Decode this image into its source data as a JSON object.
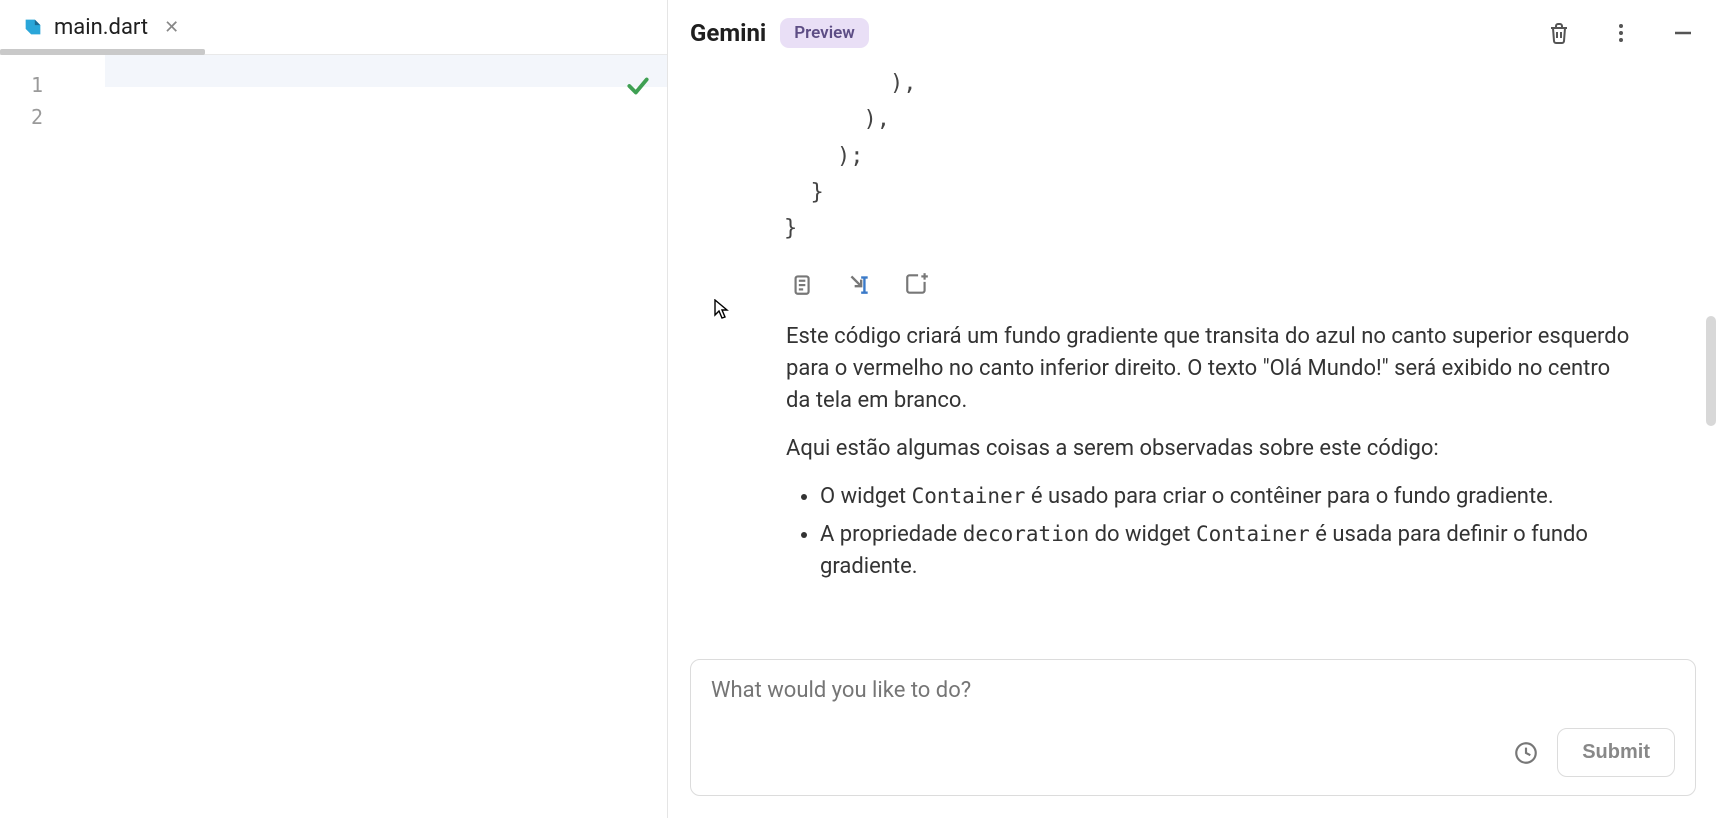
{
  "editor": {
    "tab": {
      "filename": "main.dart"
    },
    "gutter": [
      "1",
      "2"
    ],
    "current_line": 0
  },
  "gemini": {
    "title": "Gemini",
    "badge": "Preview",
    "code_tail": "        ),\n      ),\n    );\n  }\n}",
    "msg": {
      "p1": "Este código criará um fundo gradiente que transita do azul no canto superior esquerdo para o vermelho no canto inferior direito. O texto \"Olá Mundo!\" será exibido no centro da tela em branco.",
      "p2": "Aqui estão algumas coisas a serem observadas sobre este código:",
      "li1_a": "O widget ",
      "li1_code": "Container",
      "li1_b": " é usado para criar o contêiner para o fundo gradiente.",
      "li2_a": "A propriedade ",
      "li2_code1": "decoration",
      "li2_b": " do widget ",
      "li2_code2": "Container",
      "li2_c": " é usada para definir o fundo gradiente."
    },
    "input": {
      "placeholder": "What would you like to do?"
    },
    "submit": "Submit"
  }
}
